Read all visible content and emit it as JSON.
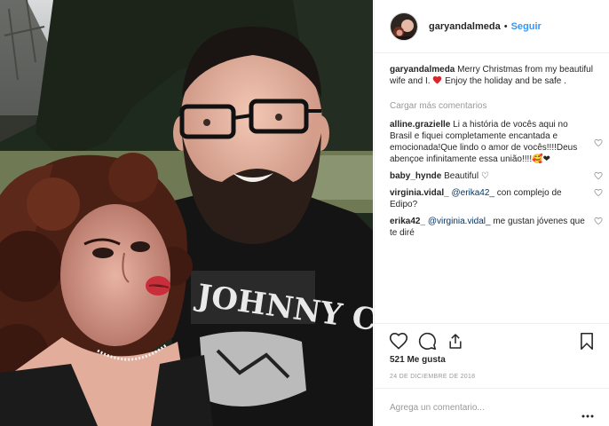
{
  "post": {
    "username": "garyandalmeda",
    "follow_label": "Seguir",
    "separator": "•"
  },
  "caption": {
    "username": "garyandalmeda",
    "text_before": " Merry Christmas from my beautiful wife and I. ",
    "text_after": " Enjoy the holiday and be safe ."
  },
  "load_more_label": "Cargar más comentarios",
  "comments": [
    {
      "username": "alline.grazielle",
      "text": " Li a história de vocês aqui no Brasil e fiquei completamente encantada e emocionada!Que lindo o amor de vocês!!!!Deus abençoe infinitamente essa união!!!!",
      "suffix": "🥰❤"
    },
    {
      "username": "baby_hynde",
      "text": " Beautiful ♡"
    },
    {
      "username": "virginia.vidal_",
      "mention": "@erika42_",
      "text": " con complejo de Edipo?"
    },
    {
      "username": "erika42_",
      "mention": "@virginia.vidal_",
      "text": " me gustan jóvenes que te diré"
    }
  ],
  "likes_label": "521 Me gusta",
  "date_label": "24 DE DICIEMBRE DE 2018",
  "comment_input": {
    "placeholder": "Agrega un comentario..."
  },
  "icons": [
    "heart-icon",
    "comment-icon",
    "share-icon",
    "bookmark-icon",
    "more-options-icon",
    "like-comment-icon"
  ],
  "colors": {
    "link": "#3897f0",
    "heart": "#ed4956",
    "muted": "#999999",
    "border": "#efefef"
  }
}
